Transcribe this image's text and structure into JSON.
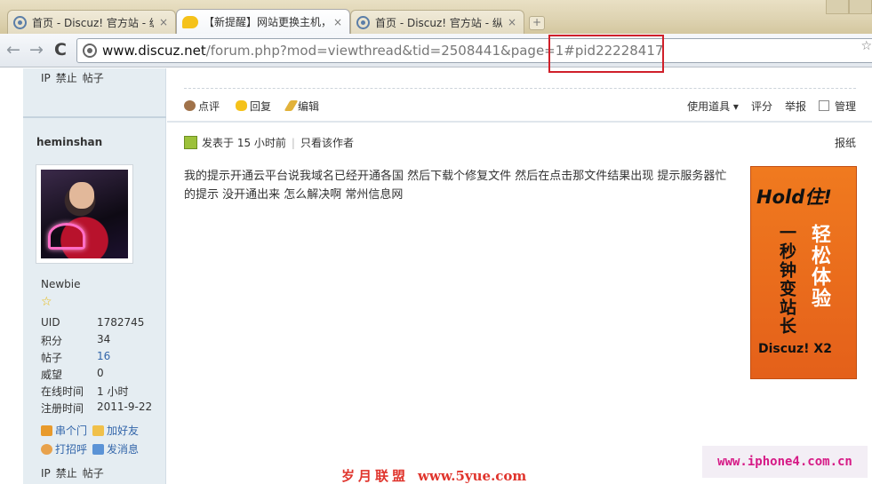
{
  "browser": {
    "tabs": [
      {
        "label": "首页 - Discuz! 官方站 - 纵",
        "close": "×"
      },
      {
        "label": "【新提醒】网站更换主机，",
        "close": "×"
      },
      {
        "label": "首页 - Discuz! 官方站 - 纵",
        "close": "×"
      }
    ],
    "new_tab": "+",
    "url_host": "www.discuz.net",
    "url_path": "/forum.php?mod=viewthread&tid=2508441&page=1#pid22228417",
    "back": "←",
    "forward": "→",
    "reload": "C",
    "star": "☆"
  },
  "sidebar": {
    "top_actions": [
      "IP",
      "禁止",
      "帖子"
    ],
    "username": "heminshan",
    "rank": "Newbie",
    "rank_star": "☆",
    "stats": [
      {
        "k": "UID",
        "v": "1782745"
      },
      {
        "k": "积分",
        "v": "34"
      },
      {
        "k": "帖子",
        "v": "16"
      },
      {
        "k": "威望",
        "v": "0"
      },
      {
        "k": "在线时间",
        "v": "1 小时"
      },
      {
        "k": "注册时间",
        "v": "2011-9-22"
      }
    ],
    "links": {
      "visit": "串个门",
      "add_friend": "加好友",
      "greet": "打招呼",
      "message": "发消息"
    },
    "bottom_actions": [
      "IP",
      "禁止",
      "帖子"
    ]
  },
  "post": {
    "actions": {
      "rate": "点评",
      "reply": "回复",
      "edit": "编辑",
      "tools": "使用道具 ▾",
      "score": "评分",
      "report": "举报",
      "manage": "管理"
    },
    "meta": {
      "posted": "发表于 15 小时前",
      "divider": "|",
      "only_author": "只看该作者",
      "report": "报纸"
    },
    "body": "我的提示开通云平台说我域名已经开通各国 然后下载个修复文件 然后在点击那文件结果出现 提示服务器忙的提示 没开通出来 怎么解决啊 常州信息网"
  },
  "ad": {
    "headline": "Hold住!",
    "col1": "一秒钟变站长",
    "col2": "轻松体验",
    "brand": "Discuz! X2"
  },
  "watermarks": {
    "cn": "岁月联盟",
    "site": "www.5yue.com",
    "right": "www.iphone4.com.cn"
  }
}
